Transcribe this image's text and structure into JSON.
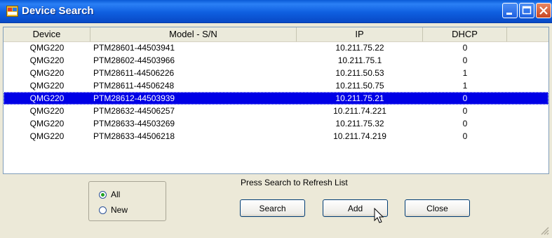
{
  "window": {
    "title": "Device Search"
  },
  "list": {
    "columns": [
      "Device",
      "Model - S/N",
      "IP",
      "DHCP"
    ],
    "rows": [
      [
        "QMG220",
        "PTM28601-44503941",
        "10.211.75.22",
        "0"
      ],
      [
        "QMG220",
        "PTM28602-44503966",
        "10.211.75.1",
        "0"
      ],
      [
        "QMG220",
        "PTM28611-44506226",
        "10.211.50.53",
        "1"
      ],
      [
        "QMG220",
        "PTM28611-44506248",
        "10.211.50.75",
        "1"
      ],
      [
        "QMG220",
        "PTM28612-44503939",
        "10.211.75.21",
        "0"
      ],
      [
        "QMG220",
        "PTM28632-44506257",
        "10.211.74.221",
        "0"
      ],
      [
        "QMG220",
        "PTM28633-44503269",
        "10.211.75.32",
        "0"
      ],
      [
        "QMG220",
        "PTM28633-44506218",
        "10.211.74.219",
        "0"
      ]
    ],
    "selected_row": 4
  },
  "filter": {
    "options": [
      {
        "label": "All",
        "checked": true
      },
      {
        "label": "New",
        "checked": false
      }
    ]
  },
  "hint": "Press Search to Refresh List",
  "buttons": {
    "search": "Search",
    "add": "Add",
    "close": "Close"
  },
  "colors": {
    "titlebar": "#0a5bd6",
    "selection": "#0000e6",
    "face": "#ece9d8"
  },
  "icons": {
    "app": "app-window-icon",
    "cursor": "mouse-pointer-icon"
  }
}
